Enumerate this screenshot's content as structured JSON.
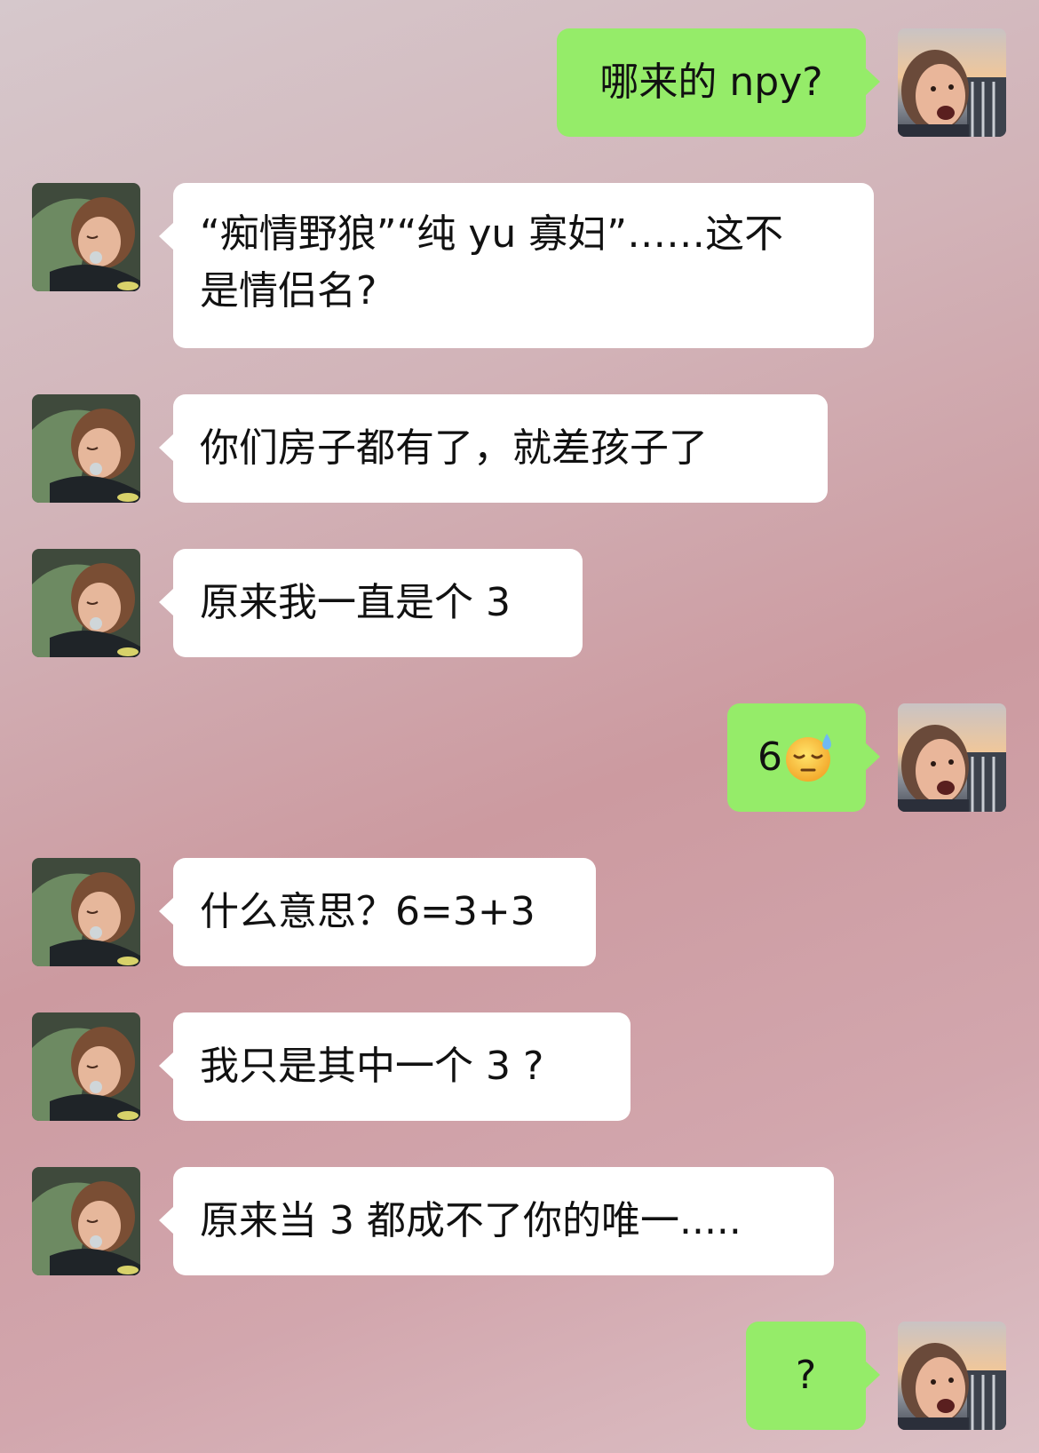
{
  "messages": [
    {
      "side": "out",
      "text": "哪来的 npy?"
    },
    {
      "side": "in",
      "text": "“痴情野狼”“纯 yu 寡妇”……这不\n是情侣名?"
    },
    {
      "side": "in",
      "text": "你们房子都有了，就差孩子了"
    },
    {
      "side": "in",
      "text": "原来我一直是个 3"
    },
    {
      "side": "out",
      "text": "6",
      "emoji": "downcast-face-with-sweat-icon"
    },
    {
      "side": "in",
      "text": "什么意思？6=3+3"
    },
    {
      "side": "in",
      "text": "我只是其中一个 3 ?"
    },
    {
      "side": "in",
      "text": "原来当 3 都成不了你的唯一....."
    },
    {
      "side": "out",
      "text": "?"
    }
  ],
  "colors": {
    "outgoing_bubble": "#95ec69",
    "incoming_bubble": "#ffffff",
    "text": "#111111"
  },
  "avatars": {
    "self": "photo-avatar-laughing-child",
    "friend": "photo-avatar-sleeping-child"
  }
}
